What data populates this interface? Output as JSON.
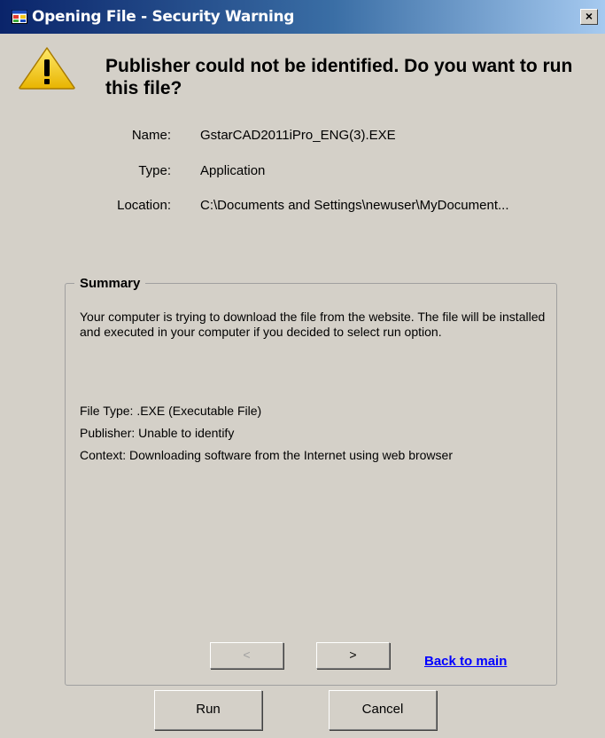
{
  "window": {
    "title": "Opening File - Security Warning",
    "close_label": "×"
  },
  "headline": "Publisher could not be identified. Do you want to run this file?",
  "file_info": {
    "name_label": "Name:",
    "name_value": "GstarCAD2011iPro_ENG(3).EXE",
    "type_label": "Type:",
    "type_value": "Application",
    "location_label": "Location:",
    "location_value": "C:\\Documents and Settings\\newuser\\MyDocument..."
  },
  "summary": {
    "title": "Summary",
    "description": "Your computer is trying to download the file from the website. The file will be installed and executed in your computer if you decided to select run option.",
    "file_type": "File Type: .EXE (Executable File)",
    "publisher": "Publisher: Unable to identify",
    "context": "Context: Downloading software from the Internet using web browser",
    "prev_label": "<",
    "next_label": ">",
    "back_link": "Back to main"
  },
  "buttons": {
    "run": "Run",
    "cancel": "Cancel"
  },
  "icons": {
    "app": "app-window-icon",
    "warning": "warning-triangle-icon"
  },
  "colors": {
    "dialog_bg": "#d4d0c8",
    "titlebar_start": "#0a246a",
    "titlebar_end": "#a6caf0",
    "link": "#0000ff"
  }
}
